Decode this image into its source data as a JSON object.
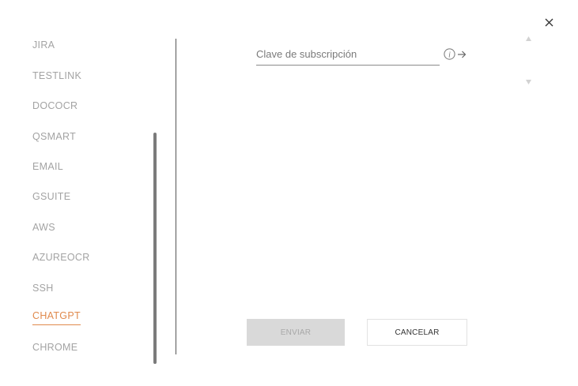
{
  "dialog": {
    "close_icon": "close-icon"
  },
  "sidebar": {
    "items": [
      {
        "label": "JIRA",
        "active": false
      },
      {
        "label": "TESTLINK",
        "active": false
      },
      {
        "label": "DOCOCR",
        "active": false
      },
      {
        "label": "QSMART",
        "active": false
      },
      {
        "label": "EMAIL",
        "active": false
      },
      {
        "label": "GSUITE",
        "active": false
      },
      {
        "label": "AWS",
        "active": false
      },
      {
        "label": "AZUREOCR",
        "active": false
      },
      {
        "label": "SSH",
        "active": false
      },
      {
        "label": "CHATGPT",
        "active": true
      },
      {
        "label": "CHROME",
        "active": false
      }
    ]
  },
  "form": {
    "subscription_key": {
      "placeholder": "Clave de subscripción",
      "value": ""
    },
    "info_icon": "info-icon",
    "arrow_icon": "arrow-right-icon"
  },
  "buttons": {
    "send_label": "ENVIAR",
    "cancel_label": "CANCELAR"
  },
  "colors": {
    "accent": "#e08a4d",
    "inactive_text": "#a3a3a3",
    "disabled_button": "#d9d9d9"
  }
}
